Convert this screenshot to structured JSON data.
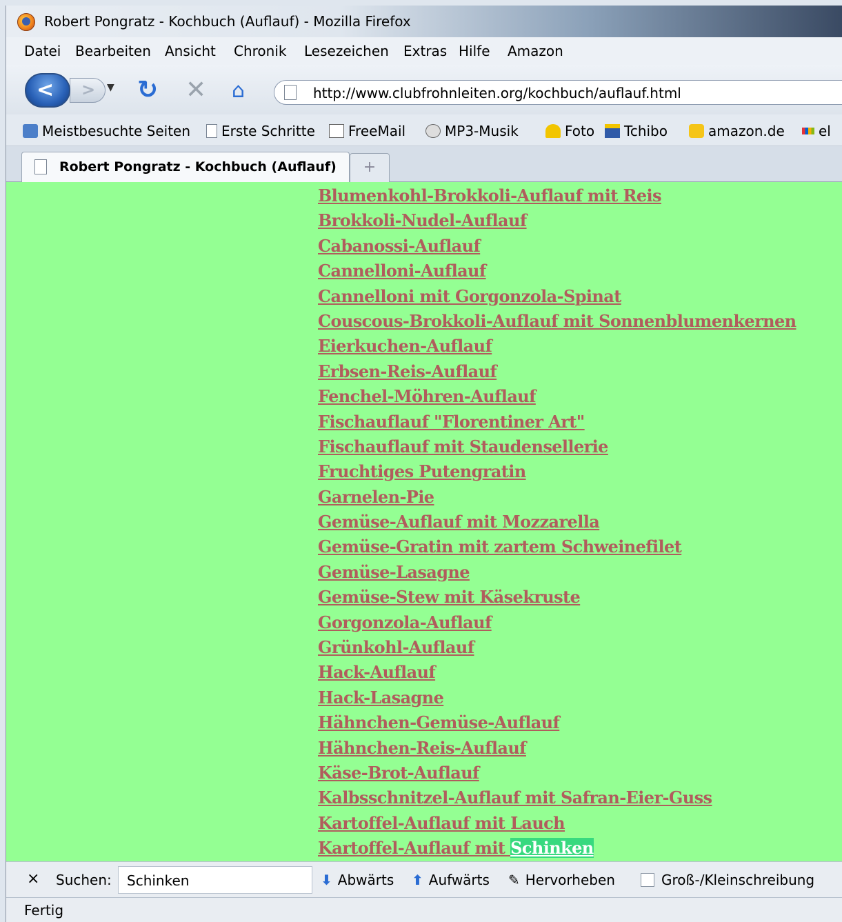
{
  "window": {
    "title": "Robert Pongratz - Kochbuch (Auflauf) - Mozilla Firefox"
  },
  "menu": [
    "Datei",
    "Bearbeiten",
    "Ansicht",
    "Chronik",
    "Lesezeichen",
    "Extras",
    "Hilfe",
    "Amazon"
  ],
  "nav": {
    "url": "http://www.clubfrohnleiten.org/kochbuch/auflauf.html"
  },
  "bookmarks": [
    "Meistbesuchte Seiten",
    "Erste Schritte",
    "FreeMail",
    "MP3-Musik",
    "Foto",
    "Tchibo",
    "amazon.de",
    "el"
  ],
  "tab": {
    "label": "Robert Pongratz - Kochbuch (Auflauf)",
    "new_tab": "+"
  },
  "recipes": [
    "Blumenkohl-Brokkoli-Auflauf mit Reis",
    "Brokkoli-Nudel-Auflauf",
    "Cabanossi-Auflauf",
    "Cannelloni-Auflauf",
    "Cannelloni mit Gorgonzola-Spinat",
    "Couscous-Brokkoli-Auflauf mit Sonnenblumenkernen",
    "Eierkuchen-Auflauf",
    "Erbsen-Reis-Auflauf",
    "Fenchel-Möhren-Auflauf",
    "Fischauflauf \"Florentiner Art\"",
    "Fischauflauf mit Staudensellerie",
    "Fruchtiges Putengratin",
    "Garnelen-Pie",
    "Gemüse-Auflauf mit Mozzarella",
    "Gemüse-Gratin mit zartem Schweinefilet",
    "Gemüse-Lasagne",
    "Gemüse-Stew mit Käsekruste",
    "Gorgonzola-Auflauf",
    "Grünkohl-Auflauf",
    "Hack-Auflauf",
    "Hack-Lasagne",
    "Hähnchen-Gemüse-Auflauf",
    "Hähnchen-Reis-Auflauf",
    "Käse-Brot-Auflauf",
    "Kalbsschnitzel-Auflauf mit Safran-Eier-Guss",
    "Kartoffel-Auflauf mit Lauch"
  ],
  "last_recipe": {
    "prefix": "Kartoffel-Auflauf mit ",
    "match": "Schinken"
  },
  "find": {
    "close": "×",
    "label": "Suchen:",
    "value": "Schinken",
    "down": "Abwärts",
    "up": "Aufwärts",
    "highlight": "Hervorheben",
    "match_case": "Groß-/Kleinschreibung"
  },
  "status": "Fertig",
  "colors": {
    "page_bg": "#94ff93",
    "link": "#b05d5d",
    "highlight": "#38d97f"
  }
}
